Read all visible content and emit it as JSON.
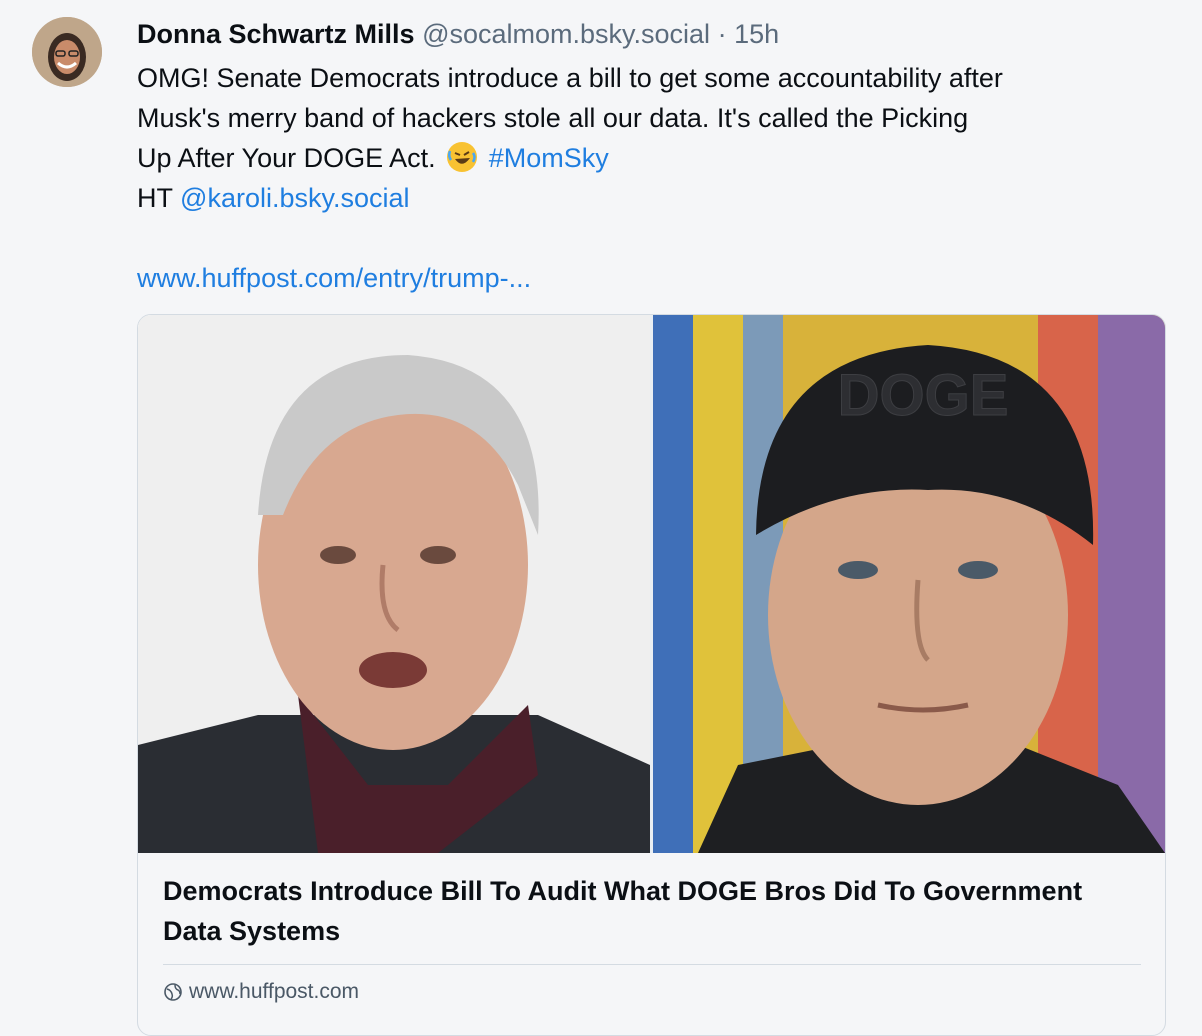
{
  "post": {
    "author": {
      "name": "Donna Schwartz Mills",
      "handle": "@socalmom.bsky.social",
      "separator": "·",
      "time": "15h"
    },
    "text": {
      "line1": " OMG! Senate Democrats introduce a bill to get some accountability after",
      "line2": "Musk's merry band of hackers stole all our data. It's called the Picking",
      "line3_prefix": "Up After Your DOGE Act.",
      "emoji_icon": "rofl-emoji",
      "hashtag": "#MomSky",
      "line4_prefix": "HT",
      "mention": "@karoli.bsky.social",
      "url": "www.huffpost.com/entry/trump-..."
    },
    "card": {
      "image_left_icon": "man-gray-hair-photo",
      "image_right_icon": "man-doge-cap-photo",
      "cap_text": "DOGE",
      "title": "Democrats Introduce Bill To Audit What DOGE Bros Did To Government Data Systems",
      "domain_icon": "globe-icon",
      "domain": "www.huffpost.com"
    }
  },
  "colors": {
    "background": "#f5f6f8",
    "link": "#1f7ee0",
    "muted": "#5b6b7c",
    "border": "#d4dbe2"
  }
}
